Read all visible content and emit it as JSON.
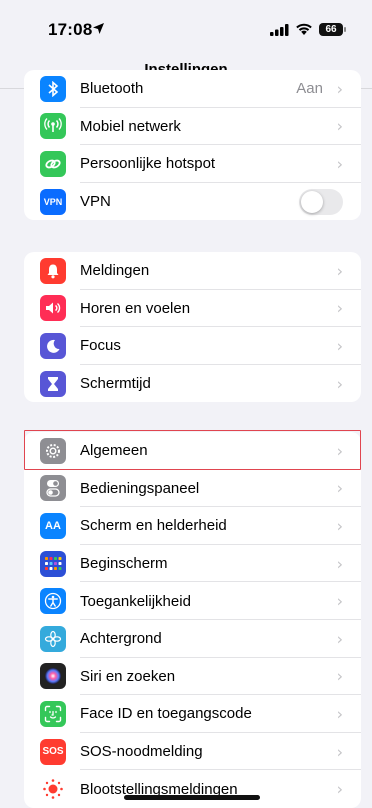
{
  "status_bar": {
    "time": "17:08",
    "battery": "66",
    "icons": [
      "location-arrow-icon",
      "cellular-signal-icon",
      "wifi-icon",
      "battery-icon"
    ]
  },
  "nav": {
    "title": "Instellingen"
  },
  "groups": [
    {
      "items": [
        {
          "label": "Bluetooth",
          "value": "Aan",
          "icon": "bluetooth-icon",
          "color": "#0a84ff"
        },
        {
          "label": "Mobiel netwerk",
          "icon": "antenna-icon",
          "color": "#34c759"
        },
        {
          "label": "Persoonlijke hotspot",
          "icon": "hotspot-icon",
          "color": "#34c759"
        },
        {
          "label": "VPN",
          "icon": "vpn-icon",
          "icon_text": "VPN",
          "color": "#0a6cff",
          "toggle": false
        }
      ]
    },
    {
      "items": [
        {
          "label": "Meldingen",
          "icon": "bell-icon",
          "color": "#ff3b30"
        },
        {
          "label": "Horen en voelen",
          "icon": "speaker-icon",
          "color": "#ff2d55"
        },
        {
          "label": "Focus",
          "icon": "moon-icon",
          "color": "#5856d6"
        },
        {
          "label": "Schermtijd",
          "icon": "hourglass-icon",
          "color": "#5856d6"
        }
      ]
    },
    {
      "items": [
        {
          "label": "Algemeen",
          "icon": "gear-icon",
          "color": "#8e8e93",
          "highlighted": true
        },
        {
          "label": "Bedieningspaneel",
          "icon": "toggles-icon",
          "color": "#8e8e93"
        },
        {
          "label": "Scherm en helderheid",
          "icon": "text-size-icon",
          "icon_text": "AA",
          "color": "#0a84ff"
        },
        {
          "label": "Beginscherm",
          "icon": "grid-icon",
          "color": "#2c4fd6"
        },
        {
          "label": "Toegankelijkheid",
          "icon": "accessibility-icon",
          "color": "#0a84ff"
        },
        {
          "label": "Achtergrond",
          "icon": "flower-icon",
          "color": "#34aadc"
        },
        {
          "label": "Siri en zoeken",
          "icon": "siri-icon",
          "color": "#222222"
        },
        {
          "label": "Face ID en toegangscode",
          "icon": "face-id-icon",
          "color": "#34c759"
        },
        {
          "label": "SOS-noodmelding",
          "icon": "sos-icon",
          "icon_text": "SOS",
          "color": "#ff3b30"
        },
        {
          "label": "Blootstellingsmeldingen",
          "icon": "exposure-icon",
          "color": "#ffffff"
        }
      ]
    }
  ],
  "chevron": "›"
}
